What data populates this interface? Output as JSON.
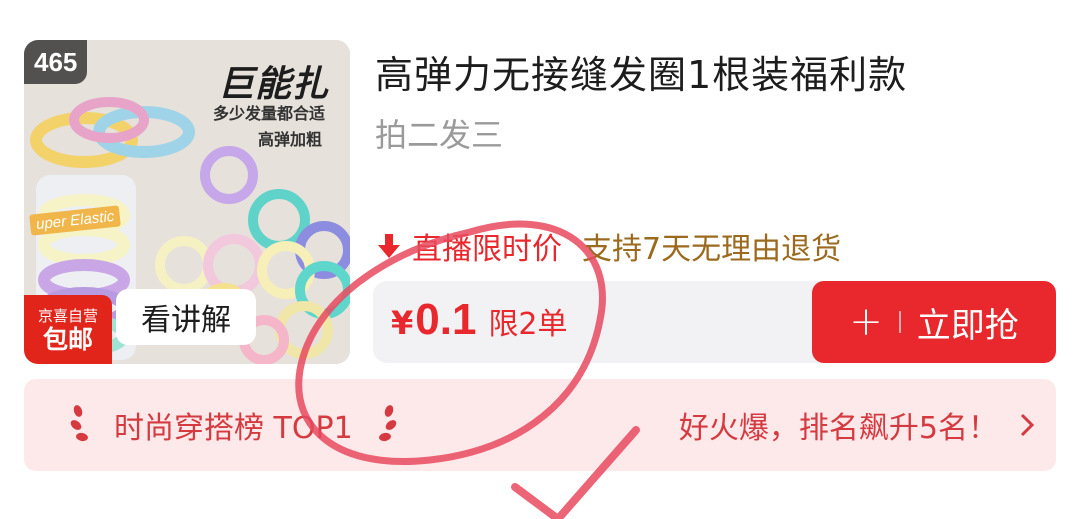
{
  "product": {
    "image_count_badge": "465",
    "image_overlay": {
      "headline": "巨能扎",
      "line1": "多少发量都合适",
      "line2": "高弹加粗",
      "box_label": "uper Elastic"
    },
    "jd_badge": {
      "line1": "京喜自营",
      "line2": "包邮"
    },
    "explain_button": "看讲解",
    "title": "高弹力无接缝发圈1根装福利款",
    "subtitle": "拍二发三",
    "tags": {
      "live_price": "直播限时价",
      "return_policy": "支持7天无理由退货"
    },
    "price": {
      "currency": "¥",
      "value": "0.1",
      "limit": "限2单"
    },
    "buy_button": {
      "plus": "+",
      "label": "立即抢"
    }
  },
  "ranking": {
    "label": "时尚穿搭榜 TOP1",
    "trend": "好火爆，排名飙升5名！"
  },
  "colors": {
    "accent_red": "#e8282d",
    "rank_bg": "#fde8ea",
    "return_tag": "#9b6a1e",
    "muted_text": "#9a9a9a"
  },
  "icons": [
    "down-arrow-icon",
    "laurel-left-icon",
    "laurel-right-icon",
    "chevron-right-icon"
  ]
}
